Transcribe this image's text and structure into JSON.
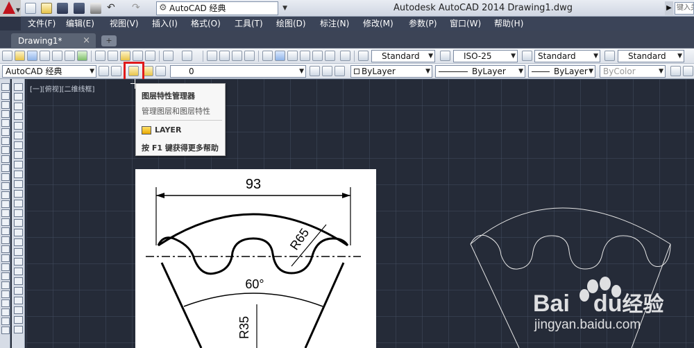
{
  "app": {
    "workspace": "AutoCAD 经典",
    "title": "Autodesk AutoCAD 2014    Drawing1.dwg",
    "search_placeholder": "键入关"
  },
  "menu": [
    "文件(F)",
    "编辑(E)",
    "视图(V)",
    "插入(I)",
    "格式(O)",
    "工具(T)",
    "绘图(D)",
    "标注(N)",
    "修改(M)",
    "参数(P)",
    "窗口(W)",
    "帮助(H)"
  ],
  "tabs": {
    "doc": "Drawing1*",
    "close": "×",
    "new": "+"
  },
  "toolbar": {
    "text_style": "Standard",
    "dim_style": "ISO-25",
    "table_style": "Standard",
    "mleader_style": "Standard",
    "workspace_combo": "AutoCAD 经典",
    "layer_combo": "0",
    "color_combo": "ByLayer",
    "linetype_combo": "ByLayer",
    "lineweight_combo": "ByLayer",
    "plotstyle_combo": "ByColor"
  },
  "tooltip": {
    "title": "图层特性管理器",
    "description": "管理图层和图层特性",
    "command": "LAYER",
    "help": "按 F1 键获得更多帮助"
  },
  "viewport": {
    "label": "[一][俯视][二维线框]"
  },
  "drawing": {
    "dim_width": "93",
    "dim_radius_outer": "R65",
    "dim_angle": "60°",
    "dim_radius_inner": "R35"
  },
  "watermark": {
    "brand": "Bai",
    "brand2": "du",
    "cn": "经验",
    "url": "jingyan.baidu.com"
  },
  "colors": {
    "menubar": "#3b4458",
    "canvas": "#252b38",
    "highlight": "#e01a1a",
    "logo": "#c0141c"
  }
}
